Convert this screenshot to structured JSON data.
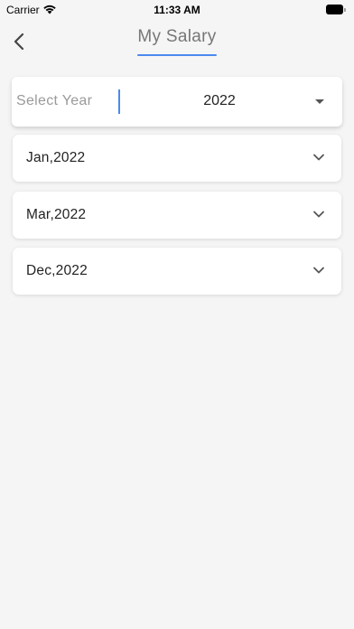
{
  "status_bar": {
    "carrier": "Carrier",
    "time": "11:33 AM"
  },
  "header": {
    "title": "My Salary",
    "accent_color": "#4a8af0"
  },
  "year_select": {
    "label": "Select Year",
    "value": "2022"
  },
  "months": [
    {
      "label": "Jan,2022"
    },
    {
      "label": "Mar,2022"
    },
    {
      "label": "Dec,2022"
    }
  ],
  "icons": {
    "back": "chevron-left-icon",
    "dropdown": "caret-down-icon",
    "expand": "chevron-down-icon"
  }
}
